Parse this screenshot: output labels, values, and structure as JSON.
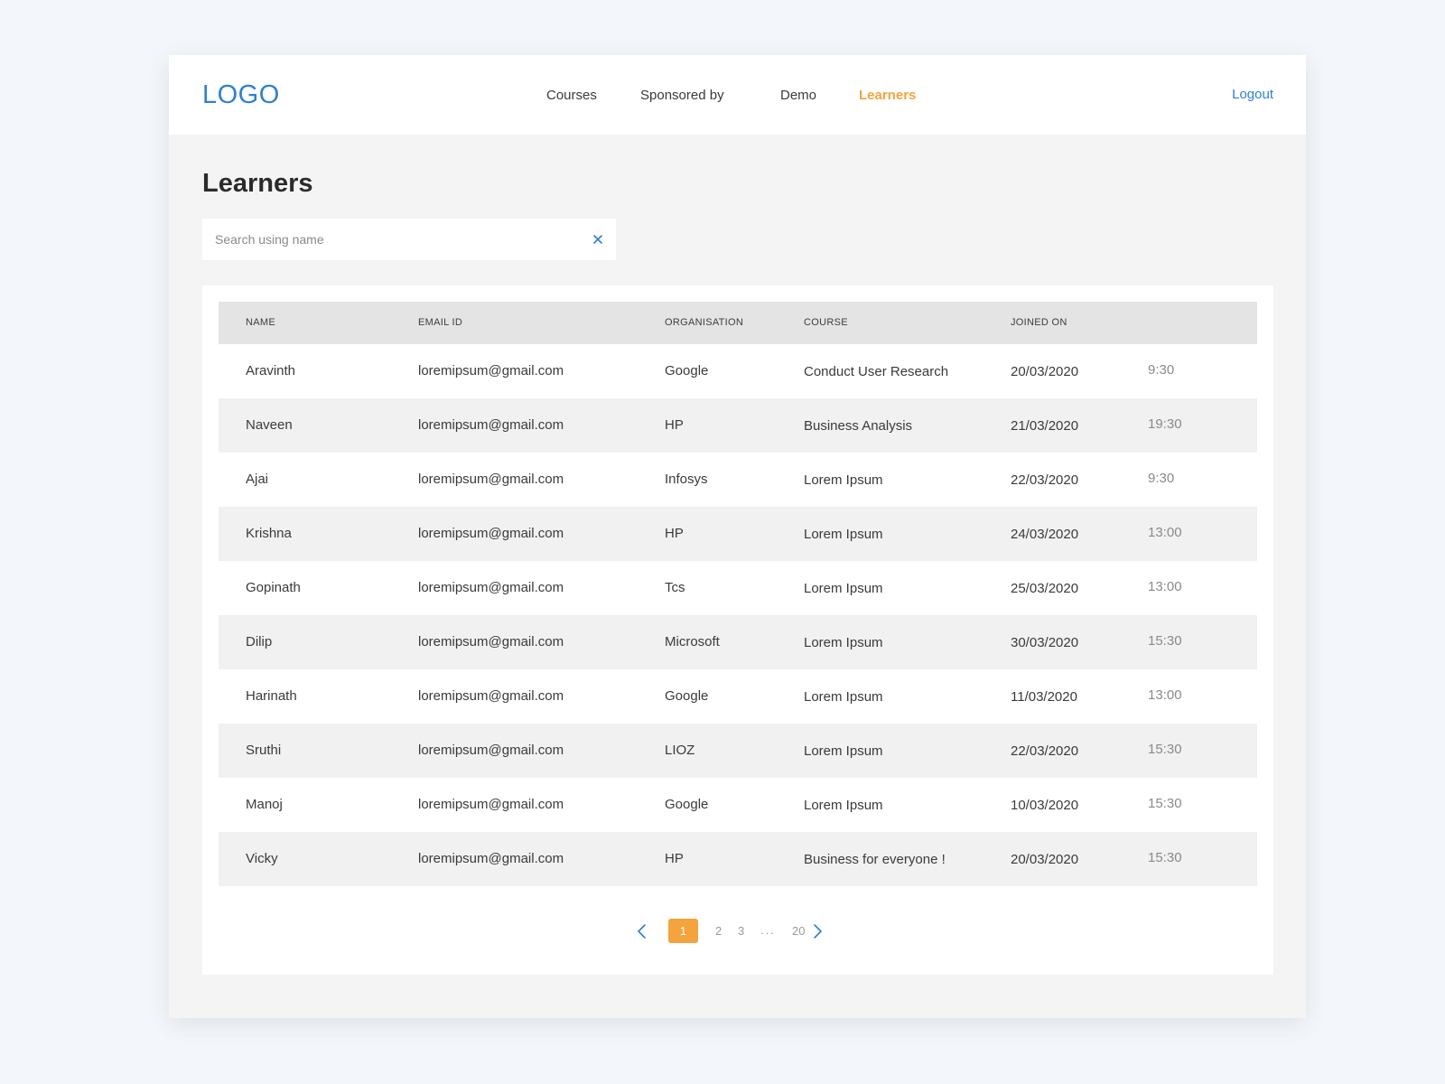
{
  "header": {
    "logo": "LOGO",
    "nav": [
      {
        "label": "Courses"
      },
      {
        "label": "Sponsored by"
      },
      {
        "label": "Demo"
      },
      {
        "label": "Learners"
      }
    ],
    "logout": "Logout"
  },
  "colors": {
    "accent": "#f5a33c",
    "link": "#2f80d1"
  },
  "page": {
    "title": "Learners"
  },
  "search": {
    "placeholder": "Search using name",
    "value": "",
    "clear_icon": "close-icon"
  },
  "table": {
    "columns": [
      "NAME",
      "EMAIL ID",
      "ORGANISATION",
      "COURSE",
      "JOINED ON"
    ],
    "rows": [
      {
        "name": "Aravinth",
        "email": "loremipsum@gmail.com",
        "org": "Google",
        "course": "Conduct User Research",
        "date": "20/03/2020",
        "time": "9:30"
      },
      {
        "name": "Naveen",
        "email": "loremipsum@gmail.com",
        "org": "HP",
        "course": "Business Analysis",
        "date": "21/03/2020",
        "time": "19:30"
      },
      {
        "name": "Ajai",
        "email": "loremipsum@gmail.com",
        "org": "Infosys",
        "course": "Lorem Ipsum",
        "date": "22/03/2020",
        "time": "9:30"
      },
      {
        "name": "Krishna",
        "email": "loremipsum@gmail.com",
        "org": "HP",
        "course": "Lorem Ipsum",
        "date": "24/03/2020",
        "time": "13:00"
      },
      {
        "name": "Gopinath",
        "email": "loremipsum@gmail.com",
        "org": "Tcs",
        "course": "Lorem Ipsum",
        "date": "25/03/2020",
        "time": "13:00"
      },
      {
        "name": "Dilip",
        "email": "loremipsum@gmail.com",
        "org": "Microsoft",
        "course": "Lorem Ipsum",
        "date": "30/03/2020",
        "time": "15:30"
      },
      {
        "name": "Harinath",
        "email": "loremipsum@gmail.com",
        "org": "Google",
        "course": "Lorem Ipsum",
        "date": "11/03/2020",
        "time": "13:00"
      },
      {
        "name": "Sruthi",
        "email": "loremipsum@gmail.com",
        "org": "LIOZ",
        "course": "Lorem Ipsum",
        "date": "22/03/2020",
        "time": "15:30"
      },
      {
        "name": "Manoj",
        "email": "loremipsum@gmail.com",
        "org": "Google",
        "course": "Lorem Ipsum",
        "date": "10/03/2020",
        "time": "15:30"
      },
      {
        "name": "Vicky",
        "email": "loremipsum@gmail.com",
        "org": "HP",
        "course": "Business for everyone !",
        "date": "20/03/2020",
        "time": "15:30"
      }
    ]
  },
  "pagination": {
    "current": "1",
    "pages": [
      "2",
      "3"
    ],
    "ellipsis": "...",
    "last": "20",
    "prev_icon": "chevron-left-icon",
    "next_icon": "chevron-right-icon"
  }
}
